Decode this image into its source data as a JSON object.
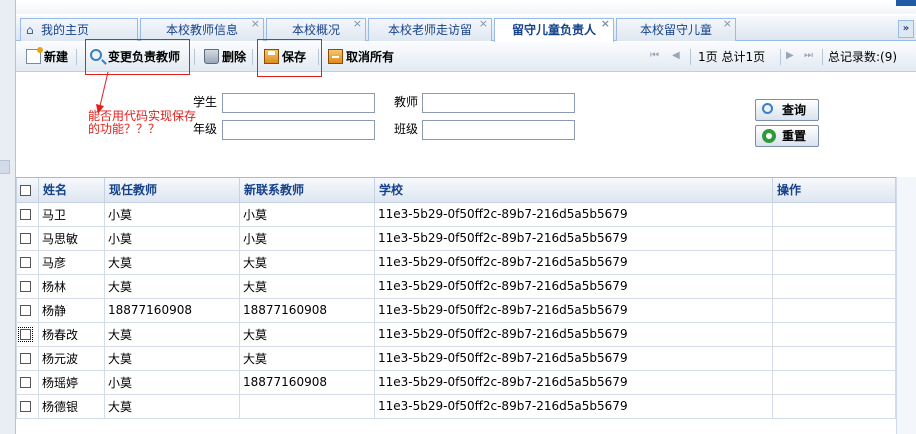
{
  "tabs": [
    {
      "label": "我的主页",
      "active": false,
      "closable": false
    },
    {
      "label": "本校教师信息",
      "active": false,
      "closable": true
    },
    {
      "label": "本校概况",
      "active": false,
      "closable": true
    },
    {
      "label": "本校老师走访留",
      "active": false,
      "closable": true
    },
    {
      "label": "留守儿童负责人",
      "active": true,
      "closable": true
    },
    {
      "label": "本校留守儿童",
      "active": false,
      "closable": true
    }
  ],
  "toolbar": {
    "new_label": "新建",
    "change_teacher_label": "变更负责教师",
    "delete_label": "删除",
    "save_label": "保存",
    "cancel_all_label": "取消所有",
    "pager_text": "1页 总计1页",
    "total_records": "总记录数:(9)"
  },
  "annotation": {
    "text": "能否用代码实现保存\n的功能？？？",
    "color": "#e0201c"
  },
  "search": {
    "student_label": "学生",
    "teacher_label": "教师",
    "grade_label": "年级",
    "class_label": "班级",
    "student_value": "",
    "teacher_value": "",
    "grade_value": "",
    "class_value": "",
    "query_label": "查询",
    "reset_label": "重置"
  },
  "grid": {
    "columns": [
      "姓名",
      "现任教师",
      "新联系教师",
      "学校",
      "操作"
    ],
    "rows": [
      {
        "name": "马卫",
        "current": "小莫",
        "new": "小莫",
        "school": "11e3-5b29-0f50ff2c-89b7-216d5a5b5679",
        "op": ""
      },
      {
        "name": "马思敏",
        "current": "小莫",
        "new": "小莫",
        "school": "11e3-5b29-0f50ff2c-89b7-216d5a5b5679",
        "op": ""
      },
      {
        "name": "马彦",
        "current": "大莫",
        "new": "大莫",
        "school": "11e3-5b29-0f50ff2c-89b7-216d5a5b5679",
        "op": ""
      },
      {
        "name": "杨林",
        "current": "大莫",
        "new": "大莫",
        "school": "11e3-5b29-0f50ff2c-89b7-216d5a5b5679",
        "op": ""
      },
      {
        "name": "杨静",
        "current": "18877160908",
        "new": "18877160908",
        "school": "11e3-5b29-0f50ff2c-89b7-216d5a5b5679",
        "op": ""
      },
      {
        "name": "杨春改",
        "current": "大莫",
        "new": "大莫",
        "school": "11e3-5b29-0f50ff2c-89b7-216d5a5b5679",
        "op": ""
      },
      {
        "name": "杨元波",
        "current": "大莫",
        "new": "大莫",
        "school": "11e3-5b29-0f50ff2c-89b7-216d5a5b5679",
        "op": ""
      },
      {
        "name": "杨瑶婷",
        "current": "小莫",
        "new": "18877160908",
        "school": "11e3-5b29-0f50ff2c-89b7-216d5a5b5679",
        "op": ""
      },
      {
        "name": "杨德银",
        "current": "大莫",
        "new": "",
        "school": "11e3-5b29-0f50ff2c-89b7-216d5a5b5679",
        "op": ""
      }
    ]
  },
  "colors": {
    "tab_text": "#15428b",
    "header_text": "#15428b",
    "border": "#99bbe8",
    "annotation": "#e0201c"
  }
}
